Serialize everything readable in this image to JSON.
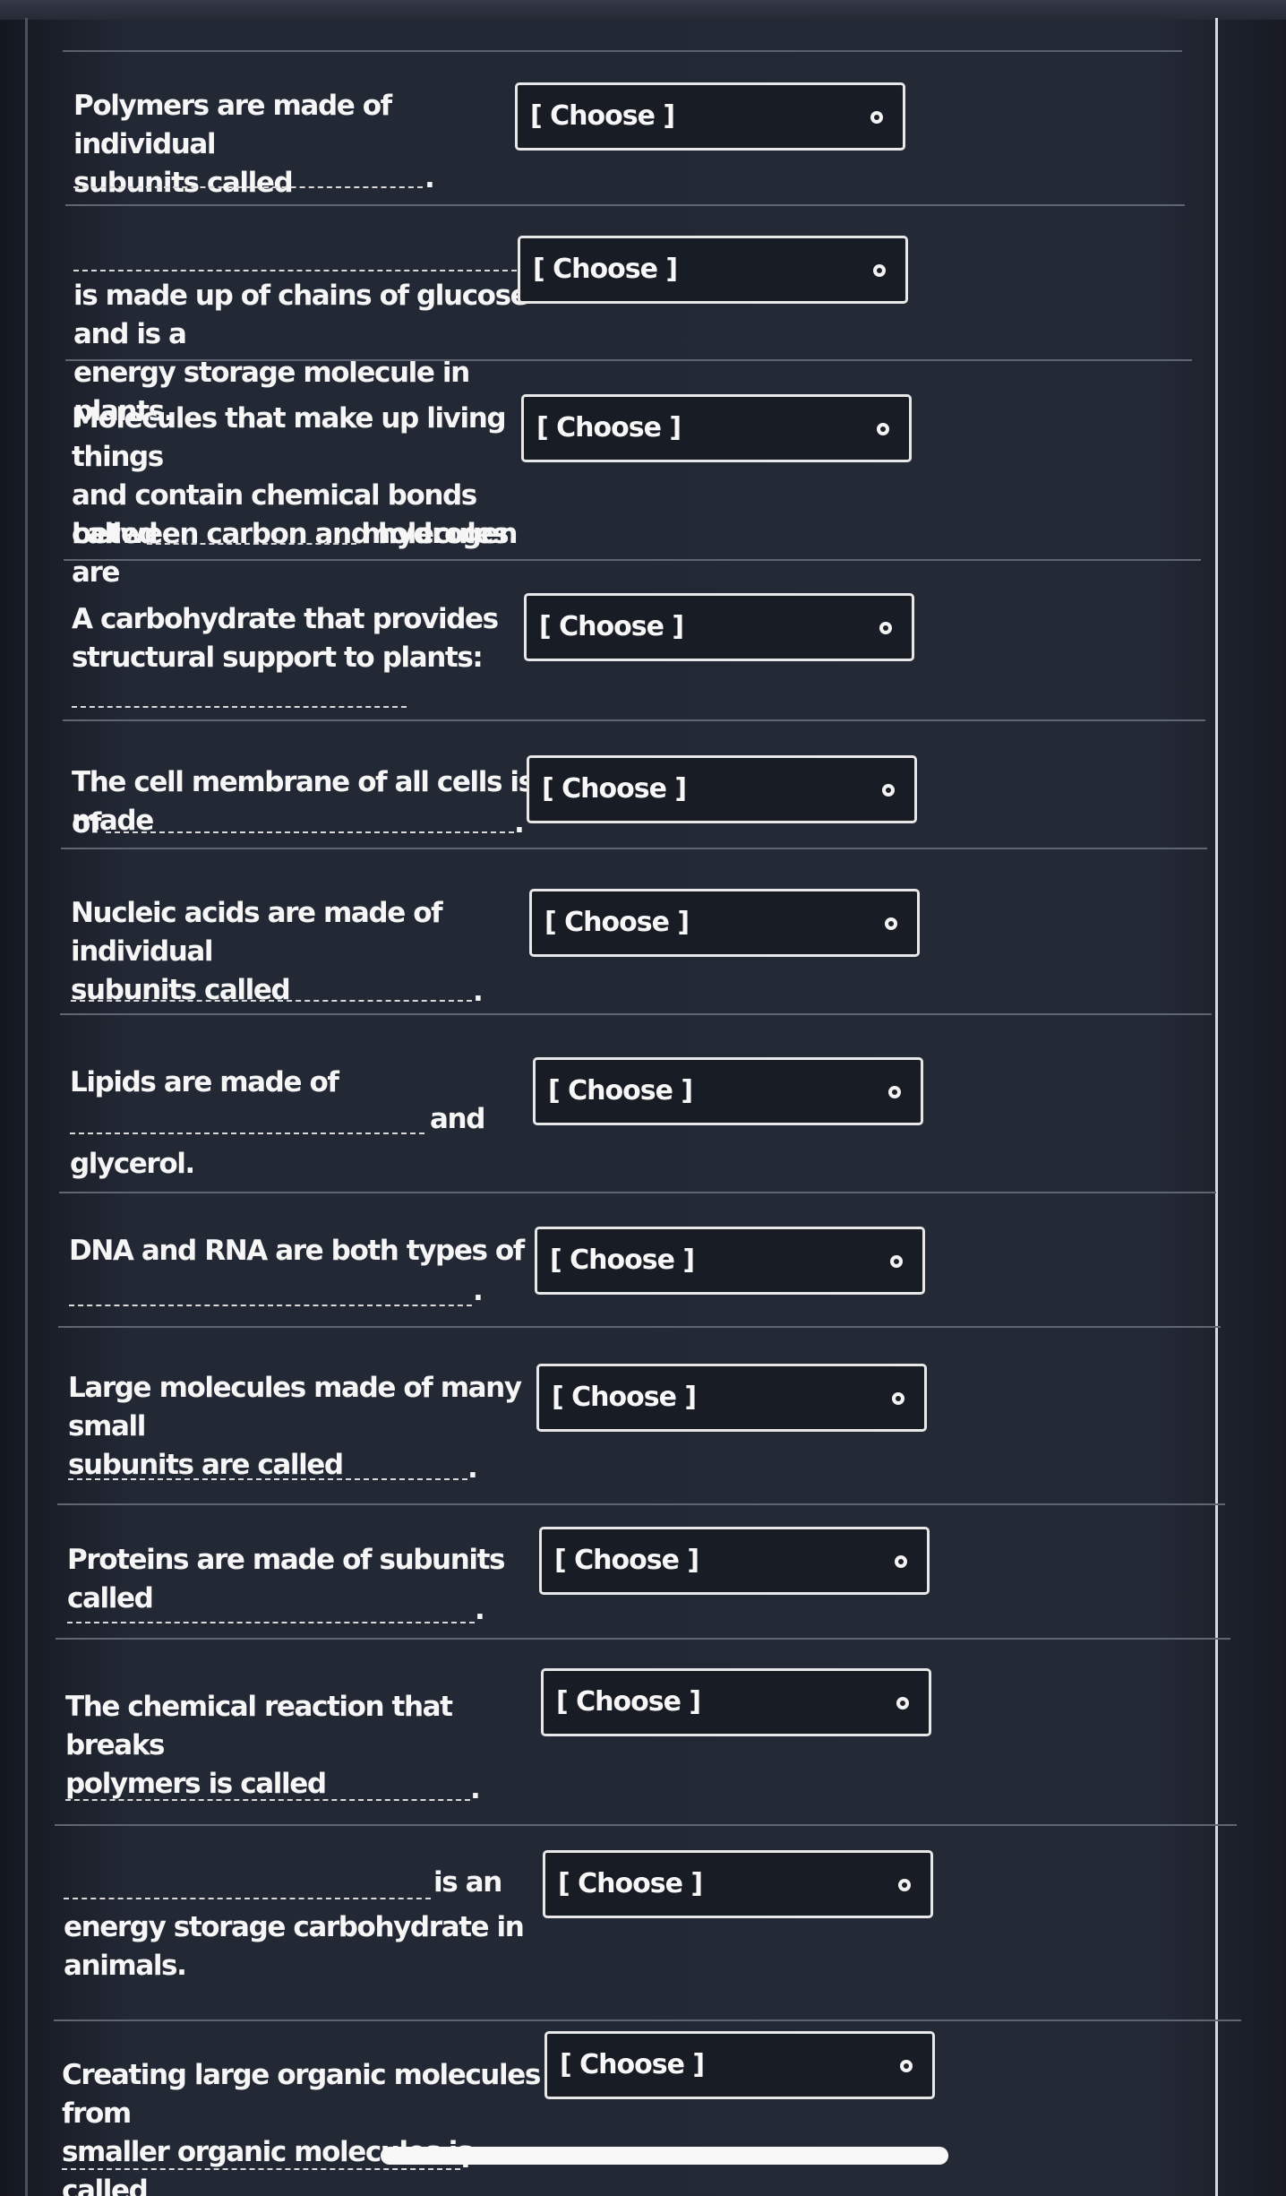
{
  "select_placeholder": "[ Choose ]",
  "questions": [
    {
      "lines": [
        "Polymers are made of individual",
        "subunits called"
      ],
      "after_blank": "."
    },
    {
      "lines": [
        "is made up of chains of glucose and is a",
        "energy storage molecule in plants."
      ]
    },
    {
      "lines": [
        "Molecules that make up living things",
        "and contain chemical bonds",
        "between carbon and hydrogen are"
      ],
      "before_blank": "called",
      "after_blank": "molecules."
    },
    {
      "lines": [
        "A carbohydrate that provides",
        "structural support to plants:"
      ]
    },
    {
      "lines": [
        "The cell membrane of all cells is made"
      ],
      "before_blank": "of",
      "after_blank": "."
    },
    {
      "lines": [
        "Nucleic acids are  made of individual",
        "subunits called"
      ],
      "after_blank": "."
    },
    {
      "lines": [
        "Lipids are made of"
      ],
      "after_blank": "and",
      "tail": "glycerol."
    },
    {
      "lines": [
        "DNA and RNA are both types of"
      ],
      "after_blank": "."
    },
    {
      "lines": [
        "Large molecules made of many small",
        "subunits are called"
      ],
      "after_blank": "."
    },
    {
      "lines": [
        "Proteins are made of subunits called"
      ],
      "after_blank": "."
    },
    {
      "lines": [
        "The chemical reaction that breaks",
        "polymers is called"
      ],
      "after_blank": "."
    },
    {
      "lines": [
        "energy storage carbohydrate in",
        "animals."
      ],
      "after_blank": "is an"
    },
    {
      "lines": [
        "Creating large organic molecules from",
        "smaller organic molecules is called"
      ],
      "after_blank": "."
    }
  ]
}
